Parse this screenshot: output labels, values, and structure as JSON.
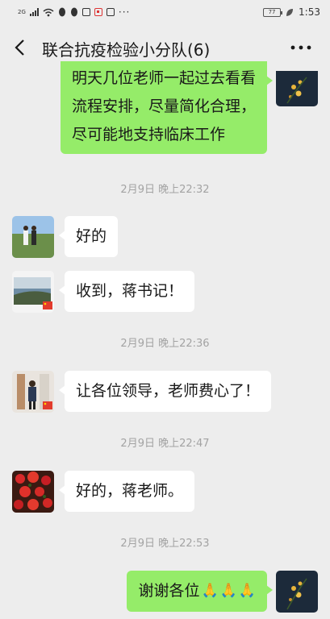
{
  "status_bar": {
    "network_label": "2G",
    "time": "1:53",
    "battery_level": "77"
  },
  "header": {
    "title": "联合抗疫检验小分队(6)",
    "back_icon": "chevron-left-icon",
    "more_icon": "ellipsis-icon"
  },
  "messages": [
    {
      "type": "sent",
      "lines": [
        "明天几位老师一起过去看看",
        "流程安排，尽量简化合理，",
        "尽可能地支持临床工作"
      ]
    },
    {
      "type": "time",
      "text": "2月9日 晚上22:32"
    },
    {
      "type": "received",
      "text": "好的"
    },
    {
      "type": "received",
      "text": "收到，蒋书记！"
    },
    {
      "type": "time",
      "text": "2月9日 晚上22:36"
    },
    {
      "type": "received",
      "text": "让各位领导，老师费心了！"
    },
    {
      "type": "time",
      "text": "2月9日 晚上22:47"
    },
    {
      "type": "received",
      "text": "好的，蒋老师。"
    },
    {
      "type": "time",
      "text": "2月9日 晚上22:53"
    },
    {
      "type": "sent",
      "text": "谢谢各位",
      "emoji": [
        "🙏",
        "🙏",
        "🙏"
      ]
    }
  ]
}
